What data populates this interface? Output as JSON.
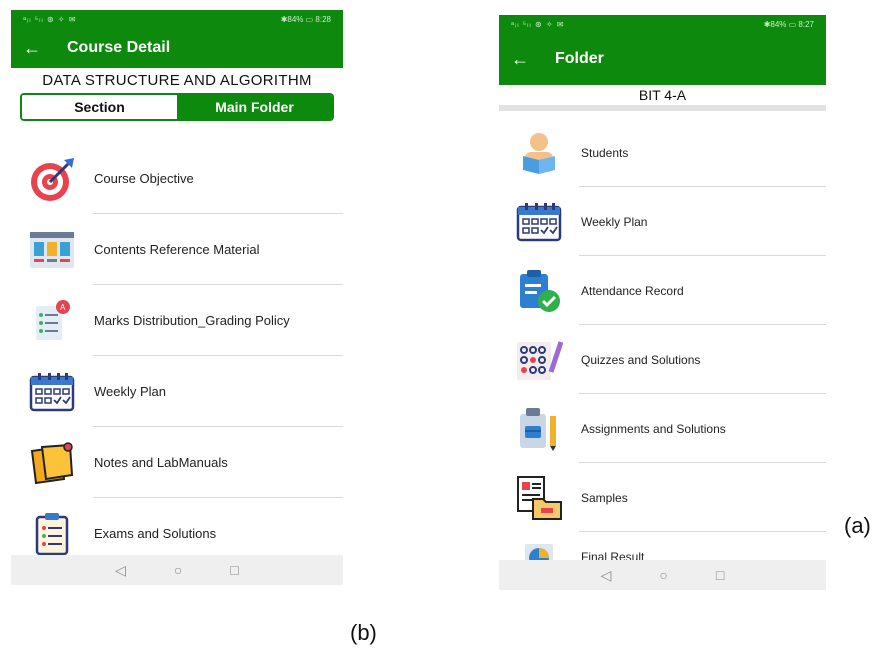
{
  "phoneB": {
    "status": {
      "signal": "ᵃᵢₗ ⁵ₗₗ ⊛ ✧ ✉",
      "right": "✱84% ▭ 8:28"
    },
    "appbar": {
      "back": "←",
      "title": "Course Detail"
    },
    "subject": "DATA STRUCTURE AND ALGORITHM",
    "tabs": {
      "section": "Section",
      "main": "Main Folder"
    },
    "items": [
      {
        "label": "Course Objective",
        "icon": "target-icon"
      },
      {
        "label": "Contents Reference Material",
        "icon": "reference-material-icon"
      },
      {
        "label": "Marks Distribution_Grading Policy",
        "icon": "grading-policy-icon"
      },
      {
        "label": "Weekly Plan",
        "icon": "calendar-icon"
      },
      {
        "label": "Notes and LabManuals",
        "icon": "sticky-note-icon"
      },
      {
        "label": "Exams and Solutions",
        "icon": "exam-clipboard-icon"
      }
    ],
    "nav": {
      "back": "◁",
      "home": "○",
      "recent": "□"
    }
  },
  "phoneA": {
    "status": {
      "signal": "ᵃᵢₗ ⁵ₗₗ ⊛ ✧ ✉",
      "right": "✱84% ▭ 8:27"
    },
    "appbar": {
      "back": "←",
      "title": "Folder"
    },
    "classname": "BIT 4-A",
    "items": [
      {
        "label": "Students",
        "icon": "student-reading-icon"
      },
      {
        "label": "Weekly Plan",
        "icon": "calendar-icon"
      },
      {
        "label": "Attendance Record",
        "icon": "attendance-clipboard-icon"
      },
      {
        "label": "Quizzes and Solutions",
        "icon": "quiz-sheet-icon"
      },
      {
        "label": "Assignments and Solutions",
        "icon": "assignment-clipboard-icon"
      },
      {
        "label": "Samples",
        "icon": "samples-folder-icon"
      },
      {
        "label": "Final Result",
        "icon": "result-chart-icon"
      }
    ],
    "nav": {
      "back": "◁",
      "home": "○",
      "recent": "□"
    }
  },
  "captions": {
    "a": "(a)",
    "b": "(b)"
  },
  "colors": {
    "appbar": "#0d8a0d",
    "divider": "#d8d8d8",
    "navbar": "#efefef"
  }
}
